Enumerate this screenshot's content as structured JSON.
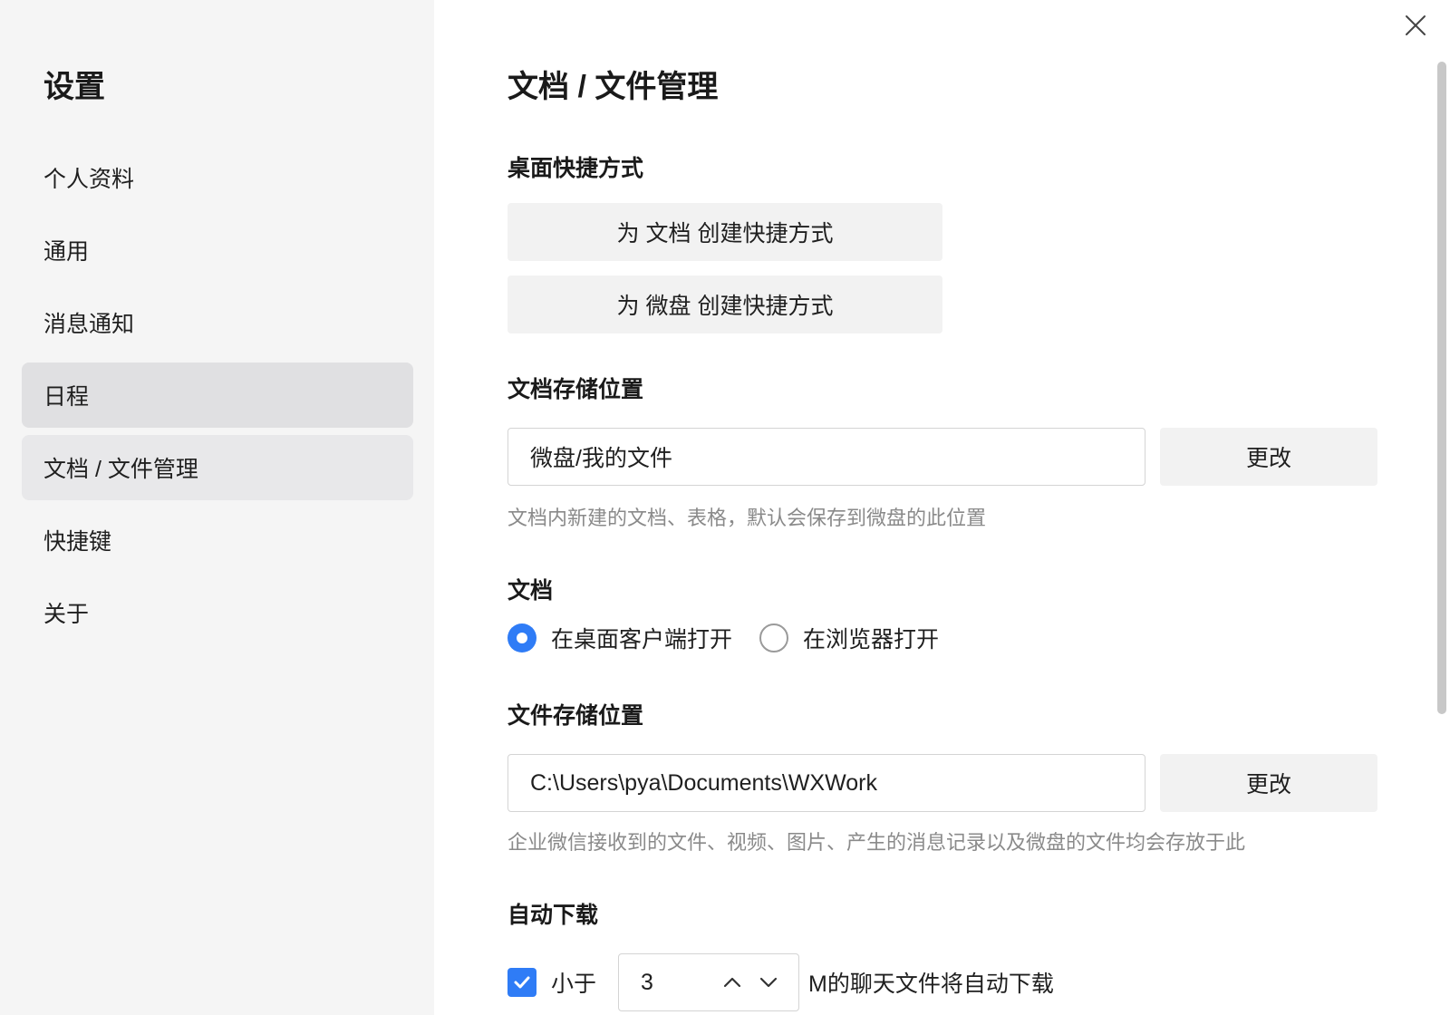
{
  "sidebar": {
    "title": "设置",
    "items": [
      {
        "label": "个人资料"
      },
      {
        "label": "通用"
      },
      {
        "label": "消息通知"
      },
      {
        "label": "日程"
      },
      {
        "label": "文档 / 文件管理"
      },
      {
        "label": "快捷键"
      },
      {
        "label": "关于"
      }
    ]
  },
  "main": {
    "title": "文档 / 文件管理",
    "shortcut": {
      "title": "桌面快捷方式",
      "doc_button": "为 文档 创建快捷方式",
      "drive_button": "为 微盘 创建快捷方式"
    },
    "doc_storage": {
      "title": "文档存储位置",
      "path": "微盘/我的文件",
      "change_label": "更改",
      "hint": "文档内新建的文档、表格，默认会保存到微盘的此位置"
    },
    "doc_open": {
      "title": "文档",
      "options": [
        {
          "label": "在桌面客户端打开",
          "checked": true
        },
        {
          "label": "在浏览器打开",
          "checked": false
        }
      ]
    },
    "file_storage": {
      "title": "文件存储位置",
      "path": "C:\\Users\\pya\\Documents\\WXWork",
      "change_label": "更改",
      "hint": "企业微信接收到的文件、视频、图片、产生的消息记录以及微盘的文件均会存放于此"
    },
    "auto_download": {
      "title": "自动下载",
      "checked": true,
      "prefix": "小于",
      "value": "3",
      "suffix": "M的聊天文件将自动下载"
    }
  },
  "colors": {
    "accent": "#2f7cf6",
    "sidebar_bg": "#f5f5f5",
    "button_bg": "#f2f2f2",
    "hint_text": "#8a8a8a"
  },
  "icons": {
    "close": "close-icon",
    "check": "check-icon",
    "stepper_up": "chevron-up-icon",
    "stepper_down": "chevron-down-icon"
  }
}
